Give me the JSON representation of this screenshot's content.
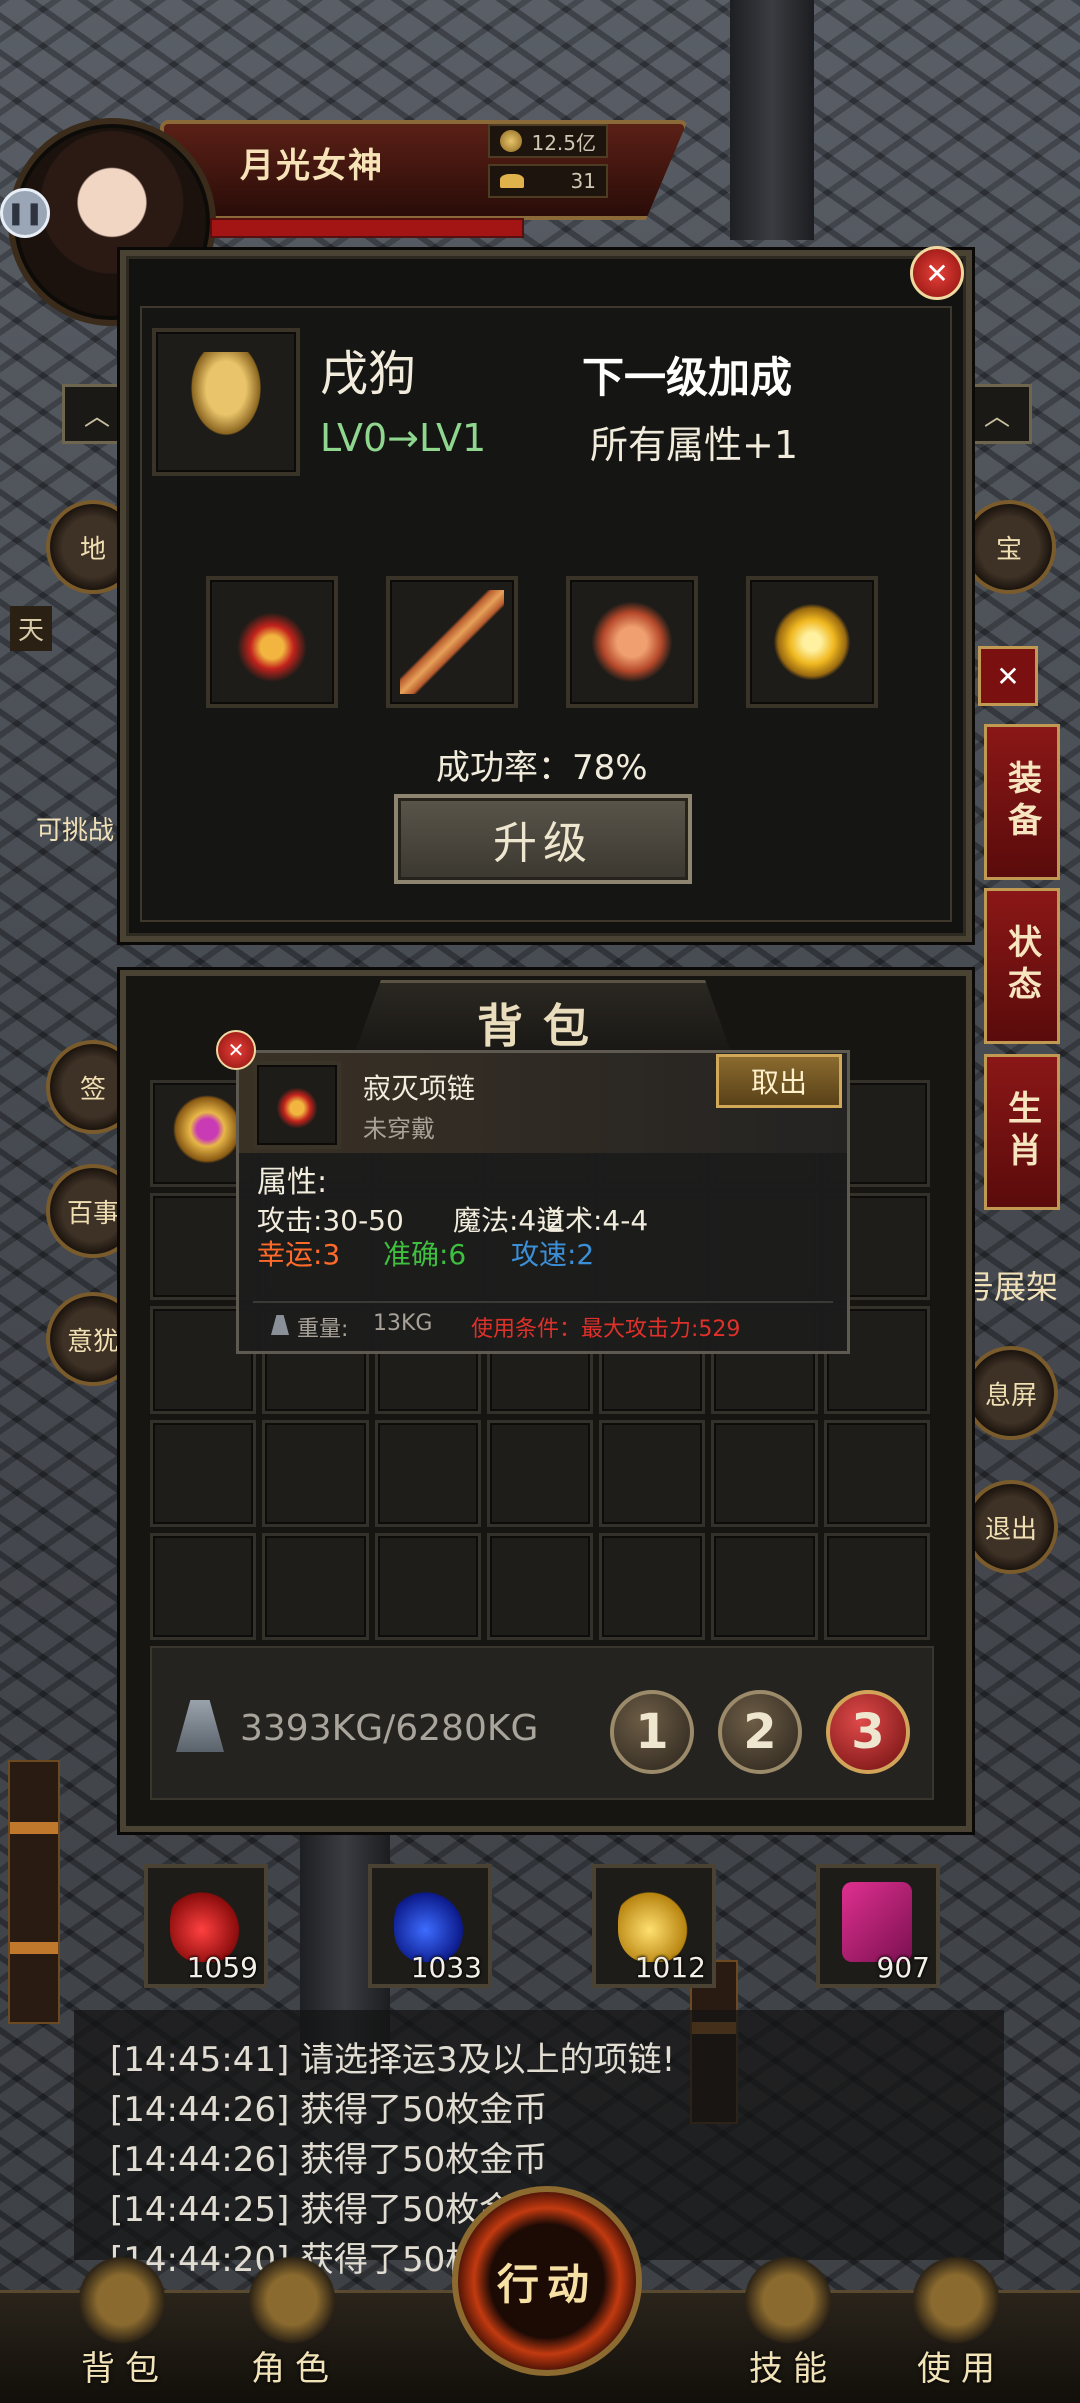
{
  "player": {
    "name": "月光女神",
    "gold": "12.5亿",
    "ingots": "31"
  },
  "left_side": {
    "buttons": [
      "地",
      "签",
      "百事",
      "意犹"
    ],
    "boss_label": "可挑战",
    "sky_label": "天"
  },
  "right_side": {
    "tabs": [
      "装备",
      "状态",
      "生肖"
    ],
    "buttons": [
      "宝",
      "号展架",
      "息屏",
      "退出"
    ]
  },
  "upgrade": {
    "zodiac_name": "戌狗",
    "level_change": "LV0→LV1",
    "bonus_title": "下一级加成",
    "bonus_value": "所有属性+1",
    "success_rate": "成功率：78%",
    "upgrade_button": "升级",
    "materials": [
      "red-necklace-icon",
      "spear-icon",
      "bracer-icon",
      "gold-ore-icon"
    ]
  },
  "bag": {
    "title": "背包",
    "weight": "3393KG/6280KG",
    "pages": [
      "1",
      "2",
      "3"
    ],
    "active_page": "3"
  },
  "tooltip": {
    "item_name": "寂灭项链",
    "wear_status": "未穿戴",
    "take_button": "取出",
    "attr_title": "属性:",
    "attack": "攻击:30-50",
    "magic": "魔法:4-2",
    "taoism": "道术:4-4",
    "luck": "幸运:3",
    "accuracy": "准确:6",
    "speed": "攻速:2",
    "weight_label": "重量:",
    "weight_value": "13KG",
    "condition": "使用条件：最大攻击力:529",
    "colors": {
      "luck": "#ff6a2a",
      "accuracy": "#3fbf3f",
      "speed": "#3c8fd6",
      "condition": "#e0302a"
    }
  },
  "potions": [
    {
      "count": "1059",
      "icon": "red-potion-icon"
    },
    {
      "count": "1033",
      "icon": "blue-potion-icon"
    },
    {
      "count": "1012",
      "icon": "sun-potion-icon"
    },
    {
      "count": "907",
      "icon": "scroll-pack-icon"
    }
  ],
  "chat": [
    "[14:45:41] 请选择运3及以上的项链!",
    "[14:44:26] 获得了50枚金币",
    "[14:44:26] 获得了50枚金币",
    "[14:44:25] 获得了50枚金",
    "[14:44:20] 获得了50枚"
  ],
  "nav": {
    "bag": "背包",
    "character": "角色",
    "action": "行动",
    "skills": "技能",
    "use": "使用"
  }
}
